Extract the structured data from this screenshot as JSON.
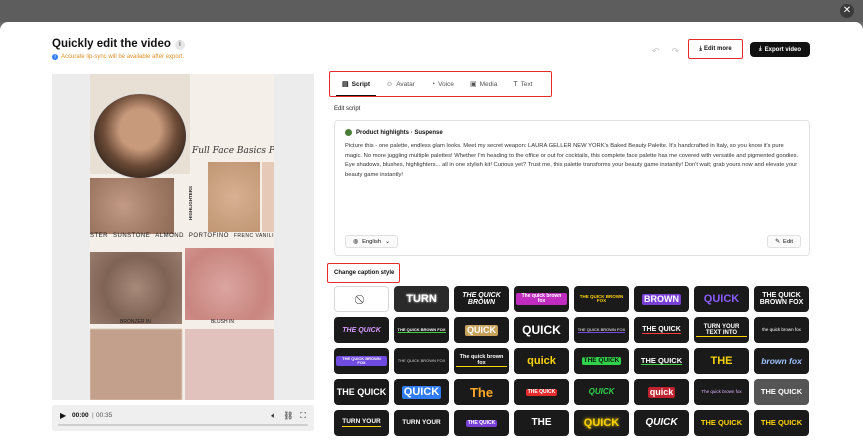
{
  "window": {
    "close_glyph": "✕"
  },
  "header": {
    "title": "Quickly edit the video",
    "notice": "Accurate lip-sync will be available after export.",
    "edit_more_label": "Edit more",
    "export_label": "Export video"
  },
  "video": {
    "palette_title": "Full Face Basics Pal",
    "highlighters_label": "HIGHLIGHTERS",
    "swatch_labels_1": [
      "STER",
      "SUNSTONE",
      "ALMOND",
      "PORTOFINO",
      "FRENC VANILI"
    ],
    "swatch_labels_2": [
      "BRONZER IN",
      "BLUSH IN"
    ],
    "time_current": "00:00",
    "time_separator": "|",
    "time_total": "00:35",
    "progress": 0
  },
  "tabs": [
    {
      "label": "Script",
      "icon": "script-icon",
      "glyph": "▤",
      "active": true
    },
    {
      "label": "Avatar",
      "icon": "avatar-icon",
      "glyph": "☺",
      "active": false
    },
    {
      "label": "Voice",
      "icon": "voice-icon",
      "glyph": "◔",
      "active": false
    },
    {
      "label": "Media",
      "icon": "media-icon",
      "glyph": "▣",
      "active": false
    },
    {
      "label": "Text",
      "icon": "text-icon",
      "glyph": "T",
      "active": false
    }
  ],
  "script": {
    "section_label": "Edit script",
    "heading": "Product highlights · Suspense",
    "body": "Picture this - one palette, endless glam looks. Meet my secret weapon: LAURA GELLER NEW YORK's Baked Beauty Palette. It's handcrafted in Italy, so you know it's pure magic. No more juggling multiple palettes! Whether I'm heading to the office or out for cocktails, this complete face palette has me covered with versatile and pigmented goodies. Eye shadows, blushes, highlighters... all in one stylish kit! Curious yet? Trust me, this palette transforms your beauty game instantly! Don't wait; grab yours now and elevate your beauty game instantly!",
    "language": "English",
    "edit_label": "Edit"
  },
  "caption": {
    "section_label": "Change caption style",
    "styles": [
      {
        "text": "⃠",
        "none": true
      },
      {
        "text": "TURN",
        "color": "#ffffff",
        "bg": "#2a2a2a",
        "size": 11,
        "weight": "bold",
        "shadow": "0 0 2px #fff"
      },
      {
        "text": "THE QUICK BROWN",
        "color": "#ffffff",
        "bg": "#1a1a1a",
        "size": 7,
        "weight": "bold",
        "italic": true
      },
      {
        "text": "The quick brown fox",
        "color": "#ffffff",
        "bg": "#1a1a1a",
        "size": 5,
        "weight": "bold",
        "hl": "#c02cc0"
      },
      {
        "text": "THE QUICK BROWN FOX",
        "color": "#ffd400",
        "bg": "#1a1a1a",
        "size": 4.5,
        "weight": "bold"
      },
      {
        "text": "BROWN",
        "color": "#ffffff",
        "bg": "#1a1a1a",
        "size": 9,
        "weight": "bold",
        "hl": "#7a3fd6"
      },
      {
        "text": "QUICK",
        "color": "#8a5cff",
        "bg": "#1a1a1a",
        "size": 11,
        "weight": "bold"
      },
      {
        "text": "THE QUICK BROWN FOX",
        "color": "#ffffff",
        "bg": "#1a1a1a",
        "size": 7,
        "weight": "bold"
      },
      {
        "text": "THE QUICK",
        "color": "#d79bff",
        "bg": "#1a1a1a",
        "size": 7,
        "weight": "bold",
        "italic": true
      },
      {
        "text": "THE QUICK BROWN FOX",
        "color": "#ffffff",
        "bg": "#1a1a1a",
        "size": 4,
        "weight": "bold",
        "accent": "#3cd23c"
      },
      {
        "text": "QUICK",
        "color": "#ffffff",
        "bg": "#1a1a1a",
        "size": 9,
        "weight": "bold",
        "hl": "#c8a15a"
      },
      {
        "text": "QUICK",
        "color": "#ffffff",
        "bg": "#1a1a1a",
        "size": 12,
        "weight": "bold"
      },
      {
        "text": "THE QUICK BROWN FOX",
        "color": "#ffffff",
        "bg": "#1a1a1a",
        "size": 4,
        "weight": "normal",
        "accent": "#6f4be0"
      },
      {
        "text": "THE QUICK",
        "color": "#ffffff",
        "bg": "#1a1a1a",
        "size": 7,
        "weight": "bold",
        "accent": "#ff3b3b"
      },
      {
        "text": "TURN YOUR TEXT INTO",
        "color": "#ffffff",
        "bg": "#1a1a1a",
        "size": 6,
        "weight": "bold",
        "accent": "#ffd400"
      },
      {
        "text": "the quick brown fox",
        "color": "#ffffff",
        "bg": "#1a1a1a",
        "size": 4.5,
        "weight": "normal"
      },
      {
        "text": "THE QUICK BROWN FOX",
        "color": "#ffffff",
        "bg": "#1a1a1a",
        "size": 4,
        "weight": "bold",
        "hl": "#6f4be0"
      },
      {
        "text": "THE QUICK BROWN FOX",
        "color": "#cfcfcf",
        "bg": "#1a1a1a",
        "size": 4,
        "weight": "normal"
      },
      {
        "text": "The quick brown fox",
        "color": "#ffffff",
        "bg": "#1a1a1a",
        "size": 5.5,
        "weight": "bold",
        "accent": "#ffd400"
      },
      {
        "text": "quick",
        "color": "#ffd400",
        "bg": "#1a1a1a",
        "size": 11,
        "weight": "bold"
      },
      {
        "text": "THE QUICK",
        "color": "#111111",
        "bg": "#1a1a1a",
        "size": 6.5,
        "weight": "bold",
        "hl": "#2fd34a"
      },
      {
        "text": "THE QUICK",
        "color": "#ffffff",
        "bg": "#1a1a1a",
        "size": 7.5,
        "weight": "bold",
        "accent": "#3cd23c"
      },
      {
        "text": "THE",
        "color": "#ffd400",
        "bg": "#1a1a1a",
        "size": 11,
        "weight": "bold"
      },
      {
        "text": "brown fox",
        "color": "#9fc3ff",
        "bg": "#1a1a1a",
        "size": 8.5,
        "weight": "bold",
        "italic": true
      },
      {
        "text": "THE QUICK",
        "color": "#ffffff",
        "bg": "#1a1a1a",
        "size": 9,
        "weight": "bold"
      },
      {
        "text": "QUICK",
        "color": "#ffffff",
        "bg": "#1a1a1a",
        "size": 11,
        "weight": "bold",
        "hl": "#2f7cf6"
      },
      {
        "text": "The",
        "color": "#ffa928",
        "bg": "#1a1a1a",
        "size": 13,
        "weight": "bold"
      },
      {
        "text": "THE QUICK",
        "color": "#ffffff",
        "bg": "#1a1a1a",
        "size": 5,
        "weight": "bold",
        "hl": "#e52c2c"
      },
      {
        "text": "QUICK",
        "color": "#2fd34a",
        "bg": "#1a1a1a",
        "size": 8,
        "weight": "bold",
        "italic": true
      },
      {
        "text": "quick",
        "color": "#ffffff",
        "bg": "#1a1a1a",
        "size": 9,
        "weight": "bold",
        "hl": "#c0222e"
      },
      {
        "text": "The quick brown fox",
        "color": "#d8b6ff",
        "bg": "#1a1a1a",
        "size": 4.5,
        "weight": "normal"
      },
      {
        "text": "THE QUICK",
        "color": "#ffffff",
        "bg": "#555555",
        "size": 7.5,
        "weight": "bold"
      },
      {
        "text": "TURN YOUR",
        "color": "#ffffff",
        "bg": "#1a1a1a",
        "size": 6.5,
        "weight": "bold",
        "accent": "#ffd400"
      },
      {
        "text": "TURN YOUR",
        "color": "#ffffff",
        "bg": "#1a1a1a",
        "size": 6.5,
        "weight": "bold"
      },
      {
        "text": "THE QUICK",
        "color": "#ffffff",
        "bg": "#1a1a1a",
        "size": 5,
        "weight": "bold",
        "hl": "#7a3fd6"
      },
      {
        "text": "THE",
        "color": "#ffffff",
        "bg": "#1a1a1a",
        "size": 10,
        "weight": "bold"
      },
      {
        "text": "QUICK",
        "color": "#ffd400",
        "bg": "#1a1a1a",
        "size": 11,
        "weight": "bold",
        "shadow": "0 0 3px #ffd400"
      },
      {
        "text": "QUICK",
        "color": "#ffffff",
        "bg": "#1a1a1a",
        "size": 10,
        "weight": "bold",
        "italic": true
      },
      {
        "text": "THE QUICK",
        "color": "#ffd400",
        "bg": "#1a1a1a",
        "size": 7.5,
        "weight": "bold"
      },
      {
        "text": "THE QUICK",
        "color": "#ffd400",
        "bg": "#1a1a1a",
        "size": 7.5,
        "weight": "bold"
      }
    ]
  }
}
